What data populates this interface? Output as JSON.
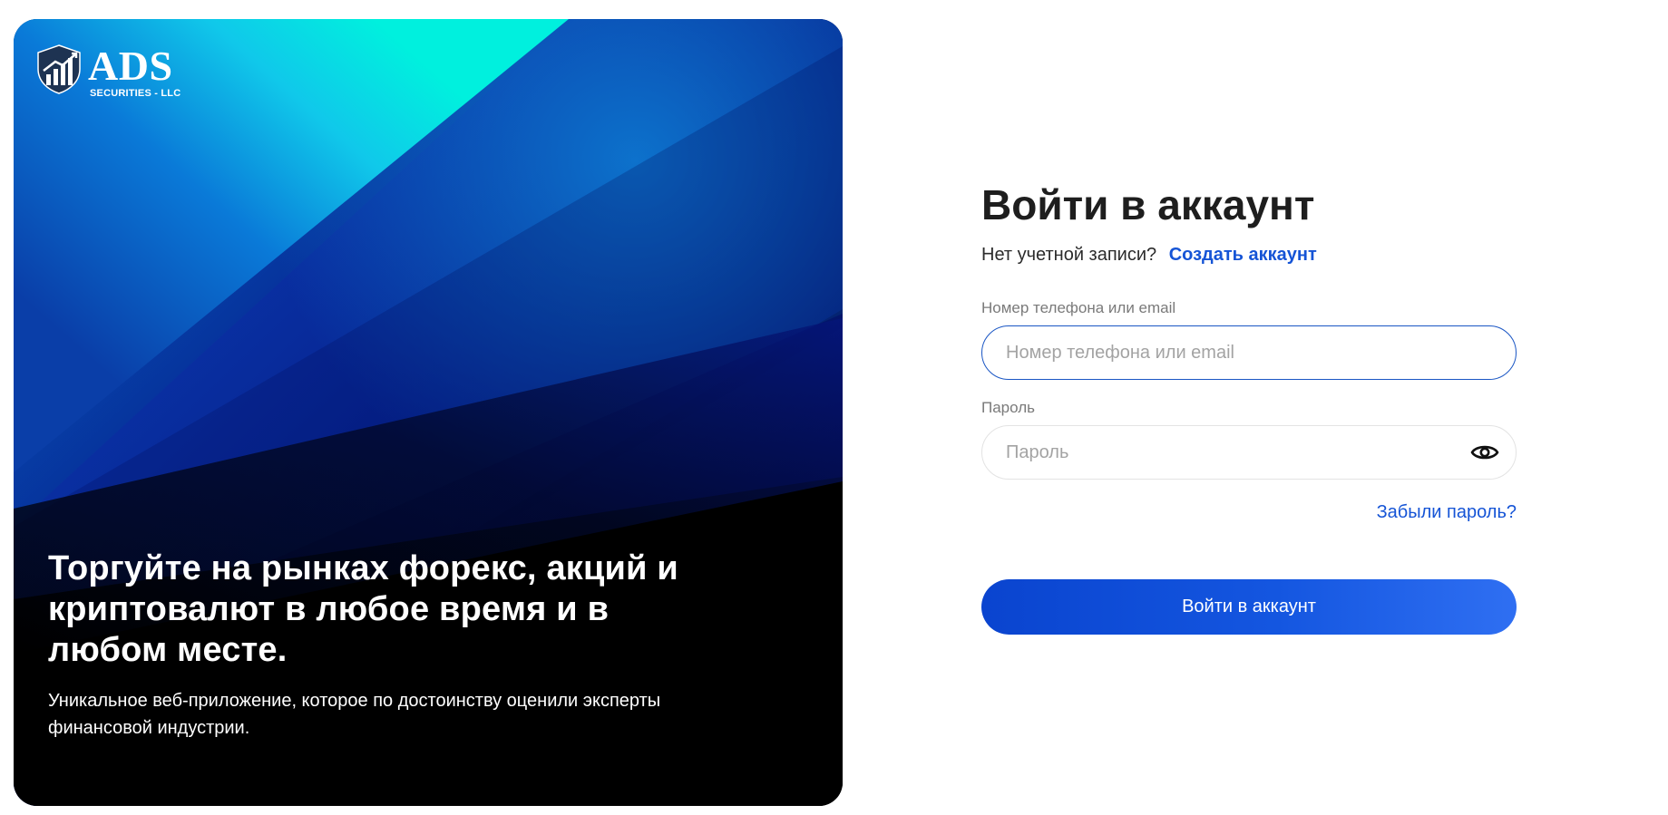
{
  "promo": {
    "logo": {
      "name": "ADS",
      "subtitle": "SECURITIES - LLC",
      "icon": "shield-chart-icon"
    },
    "headline": "Торгуйте на рынках форекс, акций и криптовалют в любое время и в любом месте.",
    "description": "Уникальное веб-приложение, которое по достоинству оценили эксперты финансовой индустрии."
  },
  "login": {
    "title": "Войти в аккаунт",
    "no_account_text": "Нет учетной записи?",
    "create_account_link": "Создать аккаунт",
    "login_field": {
      "label": "Номер телефона или email",
      "placeholder": "Номер телефона или email",
      "value": ""
    },
    "password_field": {
      "label": "Пароль",
      "placeholder": "Пароль",
      "value": "",
      "toggle_icon": "eye-icon"
    },
    "forgot_password_link": "Забыли пароль?",
    "submit_label": "Войти в аккаунт"
  },
  "colors": {
    "accent": "#1554d6",
    "button_gradient_start": "#0a44cf",
    "button_gradient_end": "#2f6ff2",
    "title": "#1e1e1e",
    "label": "#7a7a7a",
    "placeholder": "#a3a3a3",
    "focused_border": "#1a56c4"
  }
}
